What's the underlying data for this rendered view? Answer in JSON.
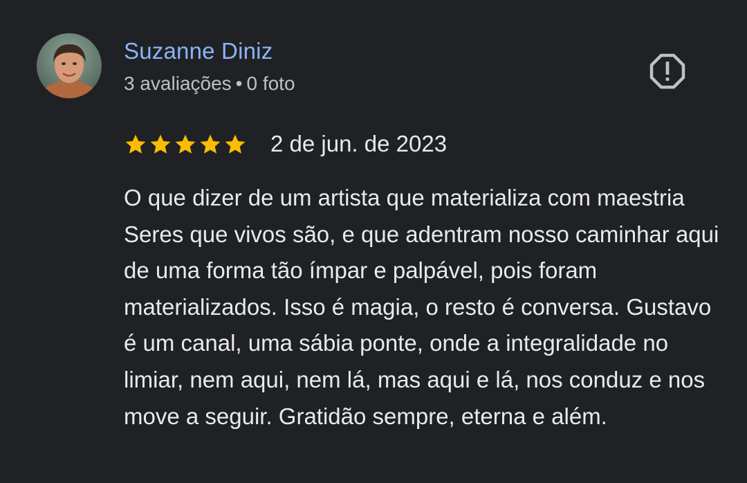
{
  "reviewer": {
    "name": "Suzanne Diniz",
    "reviews_count": "3 avaliações",
    "separator": "•",
    "photos_count": "0 foto"
  },
  "rating": {
    "stars": 5,
    "max": 5,
    "star_color": "#fbbc04",
    "date": "2 de jun. de 2023"
  },
  "review": {
    "text": "O que dizer de um artista que materializa com maestria Seres que vivos são, e que adentram nosso caminhar aqui de uma forma tão ímpar e palpável, pois foram materializados. Isso é magia, o resto é conversa. Gustavo é um canal, uma sábia ponte, onde a integralidade no limiar, nem aqui, nem lá, mas aqui e lá, nos conduz e nos move a seguir. Gratidão sempre, eterna e além."
  },
  "icons": {
    "report": "report-octagon-icon",
    "star": "star-icon"
  },
  "colors": {
    "background": "#202124",
    "name": "#8ab4f8",
    "text": "#e8eaed",
    "secondary_text": "#bdc1c6",
    "icon": "#bdc1c6"
  }
}
